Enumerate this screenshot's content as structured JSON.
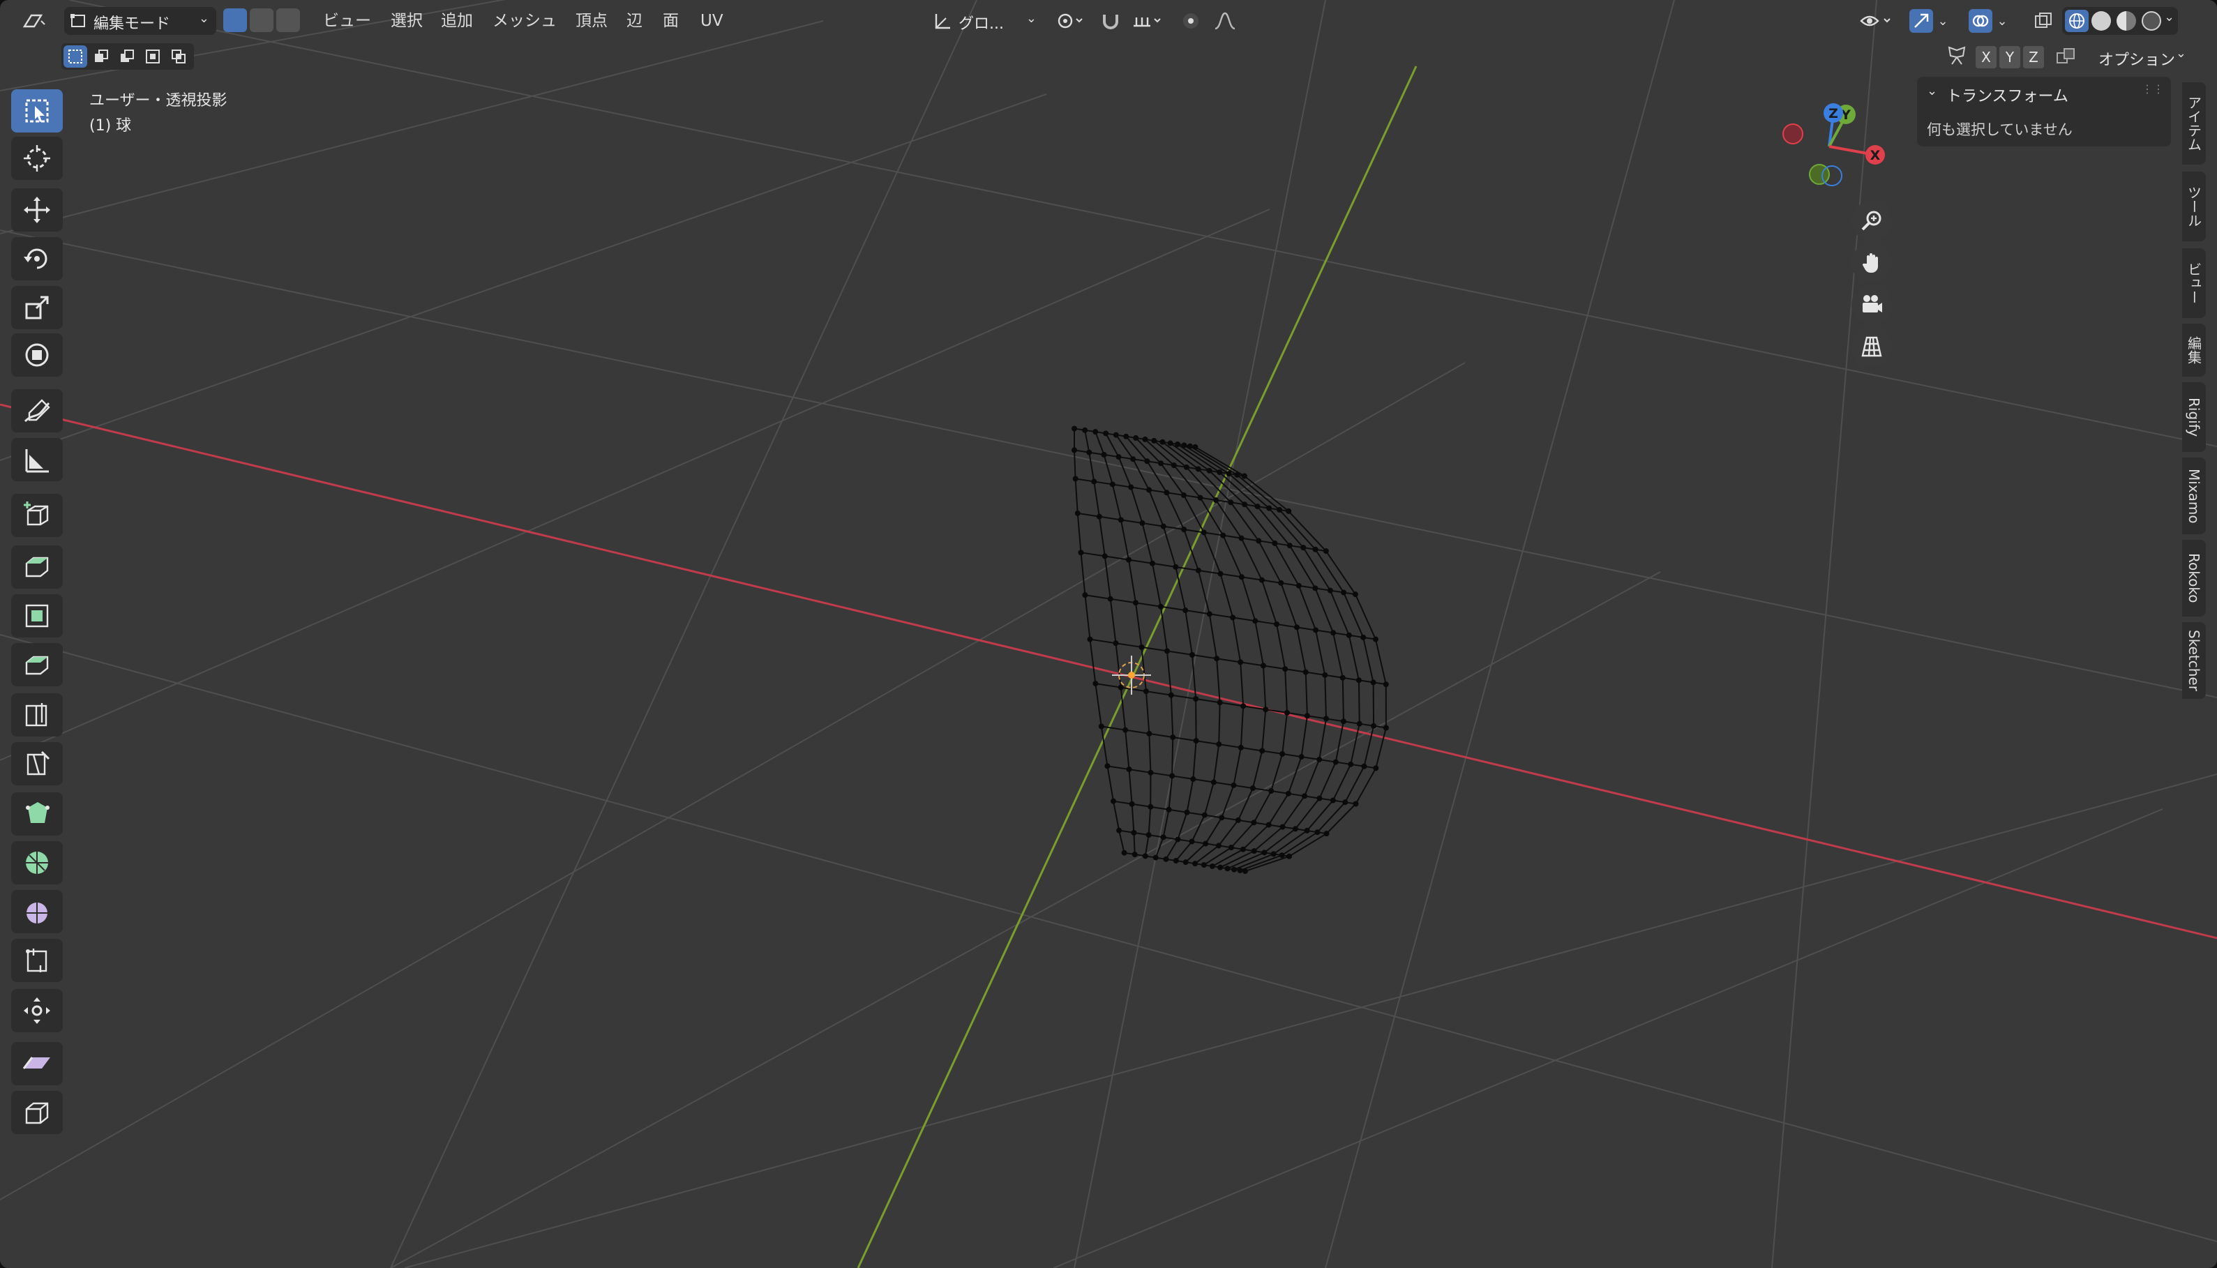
{
  "header": {
    "editor_type_icon": "mesh-editor-icon",
    "mode": "編集モード",
    "menu": [
      "ビュー",
      "選択",
      "追加",
      "メッシュ",
      "頂点",
      "辺",
      "面",
      "UV"
    ],
    "transform_orientation": "グロ...",
    "options_label": "オプション",
    "axes": [
      "X",
      "Y",
      "Z"
    ]
  },
  "viewport": {
    "view_name": "ユーザー・透視投影",
    "object_name": "(1) 球"
  },
  "gizmo": {
    "z": "Z",
    "y": "Y",
    "x": "X"
  },
  "panel": {
    "title": "トランスフォーム",
    "message": "何も選択していません"
  },
  "sidebar_tabs": [
    "アイテム",
    "ツール",
    "ビュー",
    "編集",
    "Rigify",
    "Mixamo",
    "Rokoko",
    "Sketcher"
  ],
  "toolbar": [
    "select-box-icon",
    "cursor-icon",
    "move-icon",
    "rotate-icon",
    "scale-icon",
    "transform-icon",
    "annotate-icon",
    "measure-icon",
    "add-cube-icon",
    "extrude-icon",
    "inset-icon",
    "bevel-icon",
    "loop-cut-icon",
    "knife-icon",
    "poly-build-icon",
    "spin-icon",
    "smooth-icon",
    "edge-slide-icon",
    "shrink-fatten-icon",
    "shear-icon",
    "rip-icon"
  ],
  "colors": {
    "background": "#393939",
    "grid": "#4d4d4d",
    "x_axis": "#c03b4b",
    "y_axis": "#7a9d2c",
    "accent": "#4772b3",
    "gizmo_x": "#e0404c",
    "gizmo_y": "#6ea93a",
    "gizmo_z": "#3a7ee0"
  }
}
